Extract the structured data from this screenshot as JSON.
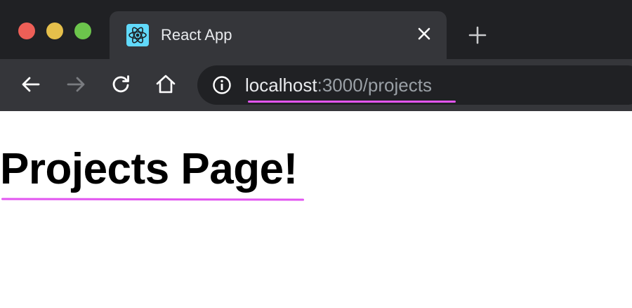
{
  "window": {
    "traffic_lights": [
      "close-button",
      "minimize-button",
      "zoom-button"
    ],
    "colors": {
      "close": "#ee5f57",
      "minimize": "#e5bf4b",
      "zoom": "#6cc54c"
    }
  },
  "tab": {
    "title": "React App",
    "favicon": "react-logo-icon",
    "close_icon": "close-icon"
  },
  "new_tab_icon": "plus-icon",
  "toolbar": {
    "back_icon": "arrow-left-icon",
    "forward_icon": "arrow-right-icon",
    "reload_icon": "reload-icon",
    "home_icon": "home-icon"
  },
  "address_bar": {
    "info_icon": "info-icon",
    "host": "localhost",
    "rest": ":3000/projects"
  },
  "page": {
    "heading": "Projects Page!"
  },
  "colors": {
    "annotation_underline": "#e255f0",
    "chrome_dark": "#202124",
    "chrome_tab": "#35363a"
  }
}
